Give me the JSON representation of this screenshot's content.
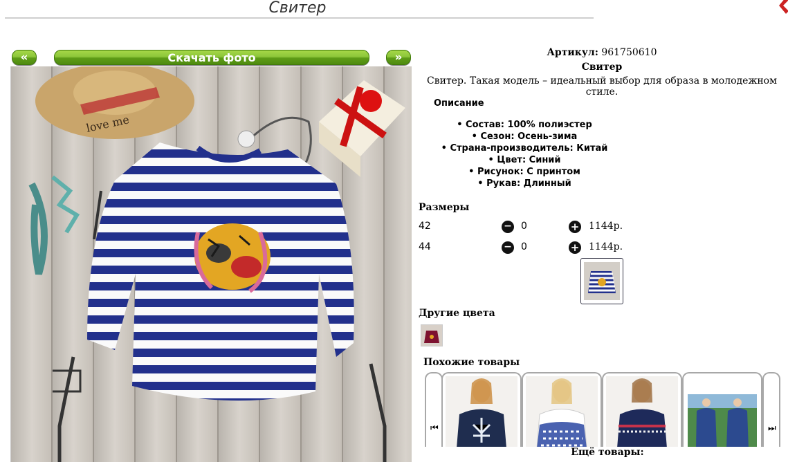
{
  "page": {
    "title": "Свитер"
  },
  "toolbar": {
    "prev_label": "«",
    "download_label": "Скачать фото",
    "next_label": "»"
  },
  "product": {
    "article_label": "Артикул:",
    "article_value": "961750610",
    "name": "Свитер",
    "tagline": "Свитер. Такая модель – идеальный выбор для образа в молодежном стиле.",
    "description_heading": "Описание",
    "specs": [
      "Состав: 100% полиэстер",
      "Сезон: Осень-зима",
      "Страна-производитель: Китай",
      "Цвет: Синий",
      "Рисунок: С принтом",
      "Рукав: Длинный"
    ]
  },
  "sizes": {
    "heading": "Размеры",
    "rows": [
      {
        "size": "42",
        "qty": "0",
        "price": "1144р."
      },
      {
        "size": "44",
        "qty": "0",
        "price": "1144р."
      }
    ]
  },
  "other_colors": {
    "heading": "Другие цвета"
  },
  "similar": {
    "heading": "Похожие товары",
    "more_label": "Ещё товары:"
  },
  "colors": {
    "button_green": "#7cb82f",
    "stripe_blue": "#1f2f8f",
    "background": "#ffffff"
  }
}
